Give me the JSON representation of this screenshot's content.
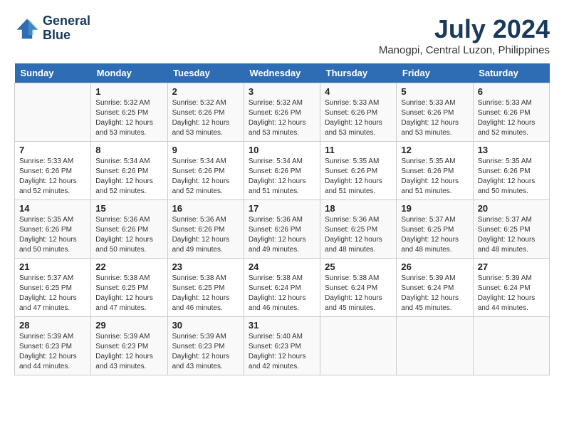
{
  "logo": {
    "line1": "General",
    "line2": "Blue"
  },
  "title": "July 2024",
  "subtitle": "Manogpi, Central Luzon, Philippines",
  "days_of_week": [
    "Sunday",
    "Monday",
    "Tuesday",
    "Wednesday",
    "Thursday",
    "Friday",
    "Saturday"
  ],
  "weeks": [
    [
      {
        "day": "",
        "sunrise": "",
        "sunset": "",
        "daylight": ""
      },
      {
        "day": "1",
        "sunrise": "Sunrise: 5:32 AM",
        "sunset": "Sunset: 6:25 PM",
        "daylight": "Daylight: 12 hours and 53 minutes."
      },
      {
        "day": "2",
        "sunrise": "Sunrise: 5:32 AM",
        "sunset": "Sunset: 6:26 PM",
        "daylight": "Daylight: 12 hours and 53 minutes."
      },
      {
        "day": "3",
        "sunrise": "Sunrise: 5:32 AM",
        "sunset": "Sunset: 6:26 PM",
        "daylight": "Daylight: 12 hours and 53 minutes."
      },
      {
        "day": "4",
        "sunrise": "Sunrise: 5:33 AM",
        "sunset": "Sunset: 6:26 PM",
        "daylight": "Daylight: 12 hours and 53 minutes."
      },
      {
        "day": "5",
        "sunrise": "Sunrise: 5:33 AM",
        "sunset": "Sunset: 6:26 PM",
        "daylight": "Daylight: 12 hours and 53 minutes."
      },
      {
        "day": "6",
        "sunrise": "Sunrise: 5:33 AM",
        "sunset": "Sunset: 6:26 PM",
        "daylight": "Daylight: 12 hours and 52 minutes."
      }
    ],
    [
      {
        "day": "7",
        "sunrise": "Sunrise: 5:33 AM",
        "sunset": "Sunset: 6:26 PM",
        "daylight": "Daylight: 12 hours and 52 minutes."
      },
      {
        "day": "8",
        "sunrise": "Sunrise: 5:34 AM",
        "sunset": "Sunset: 6:26 PM",
        "daylight": "Daylight: 12 hours and 52 minutes."
      },
      {
        "day": "9",
        "sunrise": "Sunrise: 5:34 AM",
        "sunset": "Sunset: 6:26 PM",
        "daylight": "Daylight: 12 hours and 52 minutes."
      },
      {
        "day": "10",
        "sunrise": "Sunrise: 5:34 AM",
        "sunset": "Sunset: 6:26 PM",
        "daylight": "Daylight: 12 hours and 51 minutes."
      },
      {
        "day": "11",
        "sunrise": "Sunrise: 5:35 AM",
        "sunset": "Sunset: 6:26 PM",
        "daylight": "Daylight: 12 hours and 51 minutes."
      },
      {
        "day": "12",
        "sunrise": "Sunrise: 5:35 AM",
        "sunset": "Sunset: 6:26 PM",
        "daylight": "Daylight: 12 hours and 51 minutes."
      },
      {
        "day": "13",
        "sunrise": "Sunrise: 5:35 AM",
        "sunset": "Sunset: 6:26 PM",
        "daylight": "Daylight: 12 hours and 50 minutes."
      }
    ],
    [
      {
        "day": "14",
        "sunrise": "Sunrise: 5:35 AM",
        "sunset": "Sunset: 6:26 PM",
        "daylight": "Daylight: 12 hours and 50 minutes."
      },
      {
        "day": "15",
        "sunrise": "Sunrise: 5:36 AM",
        "sunset": "Sunset: 6:26 PM",
        "daylight": "Daylight: 12 hours and 50 minutes."
      },
      {
        "day": "16",
        "sunrise": "Sunrise: 5:36 AM",
        "sunset": "Sunset: 6:26 PM",
        "daylight": "Daylight: 12 hours and 49 minutes."
      },
      {
        "day": "17",
        "sunrise": "Sunrise: 5:36 AM",
        "sunset": "Sunset: 6:26 PM",
        "daylight": "Daylight: 12 hours and 49 minutes."
      },
      {
        "day": "18",
        "sunrise": "Sunrise: 5:36 AM",
        "sunset": "Sunset: 6:25 PM",
        "daylight": "Daylight: 12 hours and 48 minutes."
      },
      {
        "day": "19",
        "sunrise": "Sunrise: 5:37 AM",
        "sunset": "Sunset: 6:25 PM",
        "daylight": "Daylight: 12 hours and 48 minutes."
      },
      {
        "day": "20",
        "sunrise": "Sunrise: 5:37 AM",
        "sunset": "Sunset: 6:25 PM",
        "daylight": "Daylight: 12 hours and 48 minutes."
      }
    ],
    [
      {
        "day": "21",
        "sunrise": "Sunrise: 5:37 AM",
        "sunset": "Sunset: 6:25 PM",
        "daylight": "Daylight: 12 hours and 47 minutes."
      },
      {
        "day": "22",
        "sunrise": "Sunrise: 5:38 AM",
        "sunset": "Sunset: 6:25 PM",
        "daylight": "Daylight: 12 hours and 47 minutes."
      },
      {
        "day": "23",
        "sunrise": "Sunrise: 5:38 AM",
        "sunset": "Sunset: 6:25 PM",
        "daylight": "Daylight: 12 hours and 46 minutes."
      },
      {
        "day": "24",
        "sunrise": "Sunrise: 5:38 AM",
        "sunset": "Sunset: 6:24 PM",
        "daylight": "Daylight: 12 hours and 46 minutes."
      },
      {
        "day": "25",
        "sunrise": "Sunrise: 5:38 AM",
        "sunset": "Sunset: 6:24 PM",
        "daylight": "Daylight: 12 hours and 45 minutes."
      },
      {
        "day": "26",
        "sunrise": "Sunrise: 5:39 AM",
        "sunset": "Sunset: 6:24 PM",
        "daylight": "Daylight: 12 hours and 45 minutes."
      },
      {
        "day": "27",
        "sunrise": "Sunrise: 5:39 AM",
        "sunset": "Sunset: 6:24 PM",
        "daylight": "Daylight: 12 hours and 44 minutes."
      }
    ],
    [
      {
        "day": "28",
        "sunrise": "Sunrise: 5:39 AM",
        "sunset": "Sunset: 6:23 PM",
        "daylight": "Daylight: 12 hours and 44 minutes."
      },
      {
        "day": "29",
        "sunrise": "Sunrise: 5:39 AM",
        "sunset": "Sunset: 6:23 PM",
        "daylight": "Daylight: 12 hours and 43 minutes."
      },
      {
        "day": "30",
        "sunrise": "Sunrise: 5:39 AM",
        "sunset": "Sunset: 6:23 PM",
        "daylight": "Daylight: 12 hours and 43 minutes."
      },
      {
        "day": "31",
        "sunrise": "Sunrise: 5:40 AM",
        "sunset": "Sunset: 6:23 PM",
        "daylight": "Daylight: 12 hours and 42 minutes."
      },
      {
        "day": "",
        "sunrise": "",
        "sunset": "",
        "daylight": ""
      },
      {
        "day": "",
        "sunrise": "",
        "sunset": "",
        "daylight": ""
      },
      {
        "day": "",
        "sunrise": "",
        "sunset": "",
        "daylight": ""
      }
    ]
  ]
}
